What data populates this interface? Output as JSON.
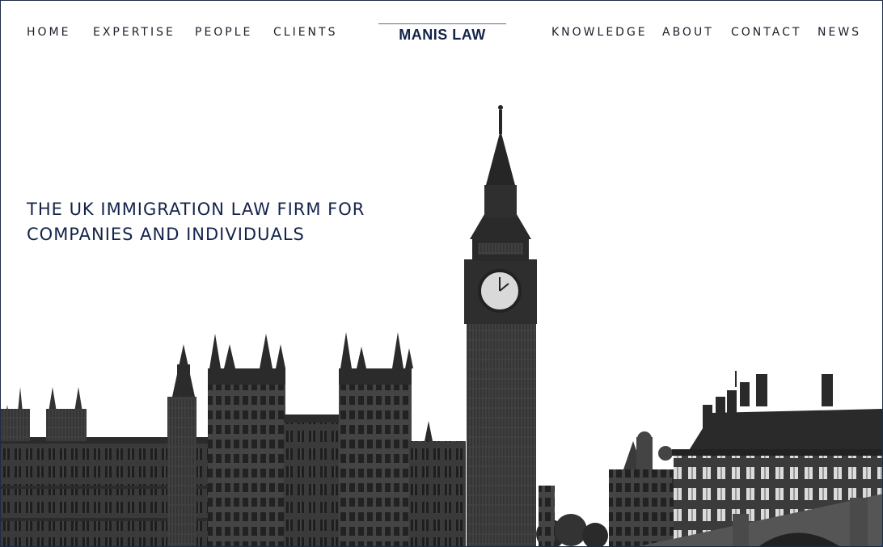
{
  "nav": {
    "left": [
      {
        "label": "HOME"
      },
      {
        "label": "EXPERTISE"
      },
      {
        "label": "PEOPLE"
      },
      {
        "label": "CLIENTS"
      }
    ],
    "right": [
      {
        "label": "KNOWLEDGE"
      },
      {
        "label": "ABOUT"
      },
      {
        "label": "CONTACT"
      },
      {
        "label": "NEWS"
      }
    ]
  },
  "logo": {
    "text": "MANIS LAW"
  },
  "hero": {
    "headline_line1": "THE UK IMMIGRATION LAW FIRM FOR",
    "headline_line2": "COMPANIES AND INDIVIDUALS",
    "image_icon": "westminster-skyline"
  },
  "colors": {
    "navy": "#13234a",
    "nav_text": "#1b1f2a",
    "stone_dark": "#2a2a2a",
    "stone_mid": "#4a4a4a"
  }
}
